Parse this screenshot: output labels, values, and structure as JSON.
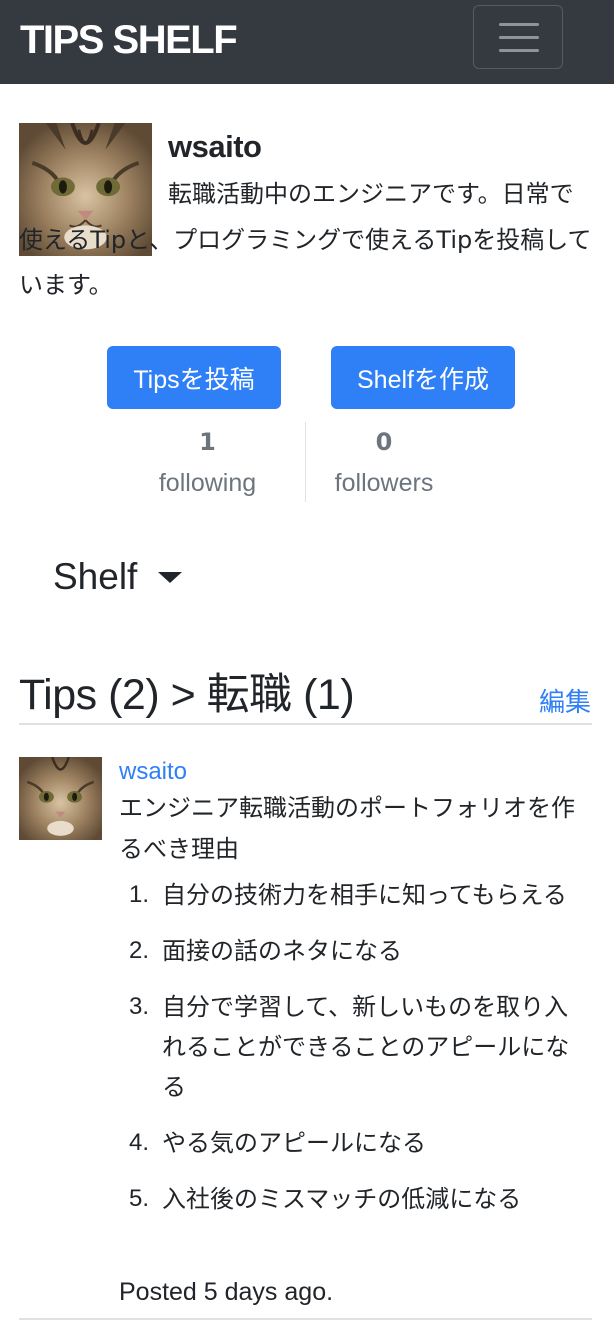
{
  "navbar": {
    "brand": "TIPS SHELF",
    "menu_icon": "hamburger-menu-icon"
  },
  "profile": {
    "username": "wsaito",
    "bio": "転職活動中のエンジニアです。日常で使えるTipと、プログラミングで使えるTipを投稿しています。",
    "avatar": "cat-avatar",
    "buttons": {
      "post_tips": "Tipsを投稿",
      "create_shelf": "Shelfを作成"
    },
    "stats": {
      "following_count": "1",
      "following_label": "following",
      "followers_count": "0",
      "followers_label": "followers"
    },
    "shelf_dropdown": "Shelf"
  },
  "tips": {
    "heading": "Tips (2) > 転職 (1)",
    "edit_label": "編集",
    "items": [
      {
        "author": "wsaito",
        "title": "エンジニア転職活動のポートフォリオを作るべき理由",
        "points": [
          "自分の技術力を相手に知ってもらえる",
          "面接の話のネタになる",
          "自分で学習して、新しいものを取り入れることができることのアピールになる",
          "やる気のアピールになる",
          "入社後のミスマッチの低減になる"
        ],
        "posted": "Posted 5 days ago."
      }
    ]
  },
  "colors": {
    "navbar_bg": "#343a40",
    "primary": "#2f7ff7",
    "muted": "#6c757d"
  }
}
